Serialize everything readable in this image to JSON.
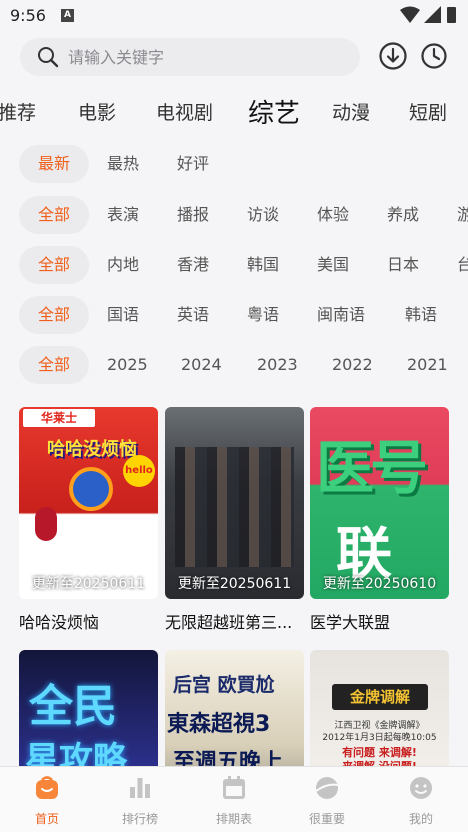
{
  "status_bar": {
    "time": "9:56",
    "notif_letter": "A"
  },
  "search": {
    "placeholder": "请输入关键字"
  },
  "channels": [
    "推荐",
    "电影",
    "电视剧",
    "综艺",
    "动漫",
    "短剧"
  ],
  "active_channel": "综艺",
  "filters": {
    "sort": [
      "最新",
      "最热",
      "好评"
    ],
    "type": [
      "全部",
      "表演",
      "播报",
      "访谈",
      "体验",
      "养成",
      "游"
    ],
    "region": [
      "全部",
      "内地",
      "香港",
      "韩国",
      "美国",
      "日本",
      "台"
    ],
    "language": [
      "全部",
      "国语",
      "英语",
      "粤语",
      "闽南语",
      "韩语"
    ],
    "year": [
      "全部",
      "2025",
      "2024",
      "2023",
      "2022",
      "2021"
    ]
  },
  "accent_color": "#f0601c",
  "cards": [
    {
      "title": "哈哈没烦恼",
      "update": "更新至20250611"
    },
    {
      "title": "无限超越班第三...",
      "update": "更新至20250611"
    },
    {
      "title": "医学大联盟",
      "update": "更新至20250610"
    },
    {
      "title": "",
      "update": ""
    },
    {
      "title": "",
      "update": ""
    },
    {
      "title": "",
      "update": ""
    }
  ],
  "posters": {
    "p1": {
      "brand": "华莱士",
      "caption": "哈哈没烦恼",
      "badge": "hello"
    },
    "p3": {
      "big": "医号",
      "small": "联"
    },
    "p4": {
      "big": "全民",
      "small": "星攻略"
    },
    "p5": {
      "lines": [
        "后宫 欧買尬",
        "東森超視3",
        "至週五晚上"
      ]
    },
    "p6": {
      "logo": "金牌调解",
      "line1": "江西卫视《金牌调解》",
      "line2": "2012年1月3日起每晚10:05",
      "line3": "有问题 来调解!",
      "line4": "来调解 没问题!"
    }
  },
  "bottom_nav": [
    {
      "label": "首页",
      "icon": "home-icon",
      "active": true
    },
    {
      "label": "排行榜",
      "icon": "ranking-icon",
      "active": false
    },
    {
      "label": "排期表",
      "icon": "calendar-icon",
      "active": false
    },
    {
      "label": "很重要",
      "icon": "planet-icon",
      "active": false
    },
    {
      "label": "我的",
      "icon": "profile-icon",
      "active": false
    }
  ]
}
